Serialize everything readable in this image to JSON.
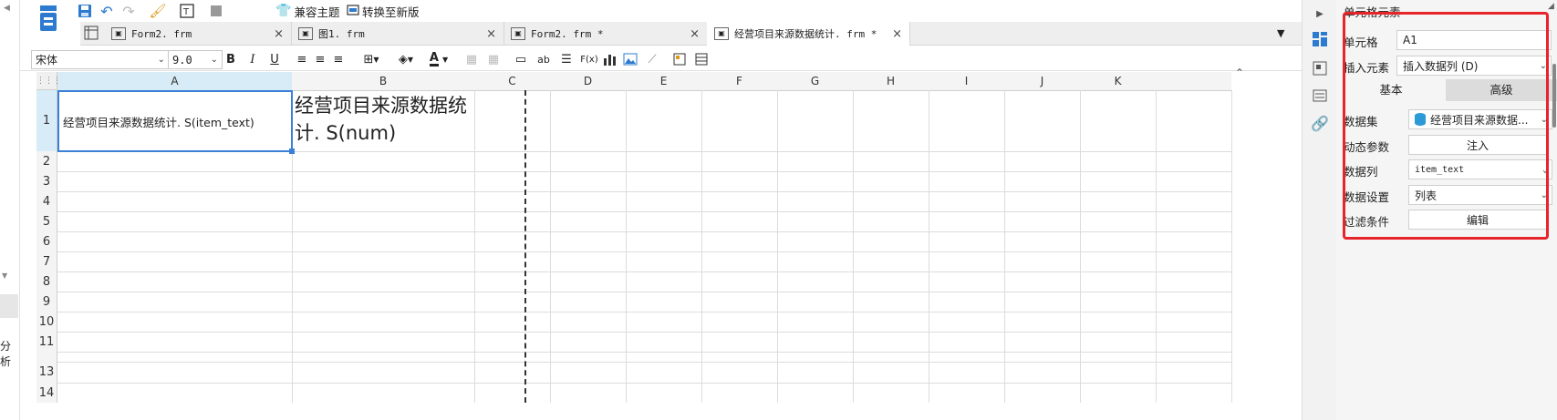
{
  "toolbar": {
    "theme_label": "兼容主题",
    "convert_label": "转换至新版"
  },
  "tabs": [
    {
      "label": "Form2. frm",
      "active": false
    },
    {
      "label": "图1. frm",
      "active": false
    },
    {
      "label": "Form2. frm *",
      "active": false
    },
    {
      "label": "经营项目来源数据统计. frm *",
      "active": true
    }
  ],
  "format_bar": {
    "font_name": "宋体",
    "font_size": "9.0",
    "bold": "B",
    "italic": "I",
    "underline": "U",
    "fx_label": "F(x)",
    "ab_label": "ab"
  },
  "grid": {
    "columns": [
      "A",
      "B",
      "C",
      "D",
      "E",
      "F",
      "G",
      "H",
      "I",
      "J",
      "K"
    ],
    "rows": [
      "1",
      "2",
      "3",
      "4",
      "5",
      "6",
      "7",
      "8",
      "9",
      "10",
      "11",
      "",
      "13",
      "14"
    ],
    "cell_a1": "经营项目来源数据统计. S(item_text)",
    "cell_b1": "经营项目来源数据统计. S(num)"
  },
  "left_strip": {
    "partial_label": "分析"
  },
  "right_panel": {
    "title": "单元格元素",
    "cell_label": "单元格",
    "cell_value": "A1",
    "insert_label": "插入元素",
    "insert_value": "插入数据列 (D)",
    "tab_basic": "基本",
    "tab_advanced": "高级",
    "dataset_label": "数据集",
    "dataset_value": "经营项目来源数据...",
    "dynamic_label": "动态参数",
    "inject_button": "注入",
    "column_label": "数据列",
    "column_value": "item_text",
    "setting_label": "数据设置",
    "setting_value": "列表",
    "filter_label": "过滤条件",
    "edit_button": "编辑"
  },
  "colors": {
    "accent_blue": "#2d7bd0",
    "selection_border": "#3b7fd6",
    "highlight_red": "#e8242b",
    "header_selected": "#d7ecf7"
  }
}
